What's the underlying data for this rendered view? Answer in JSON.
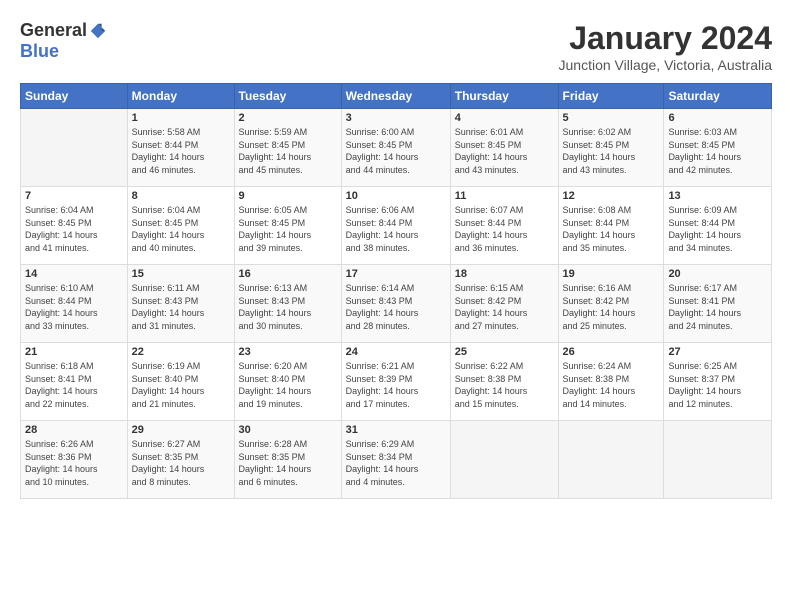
{
  "logo": {
    "general": "General",
    "blue": "Blue"
  },
  "header": {
    "title": "January 2024",
    "location": "Junction Village, Victoria, Australia"
  },
  "weekdays": [
    "Sunday",
    "Monday",
    "Tuesday",
    "Wednesday",
    "Thursday",
    "Friday",
    "Saturday"
  ],
  "weeks": [
    [
      {
        "day": "",
        "info": ""
      },
      {
        "day": "1",
        "info": "Sunrise: 5:58 AM\nSunset: 8:44 PM\nDaylight: 14 hours\nand 46 minutes."
      },
      {
        "day": "2",
        "info": "Sunrise: 5:59 AM\nSunset: 8:45 PM\nDaylight: 14 hours\nand 45 minutes."
      },
      {
        "day": "3",
        "info": "Sunrise: 6:00 AM\nSunset: 8:45 PM\nDaylight: 14 hours\nand 44 minutes."
      },
      {
        "day": "4",
        "info": "Sunrise: 6:01 AM\nSunset: 8:45 PM\nDaylight: 14 hours\nand 43 minutes."
      },
      {
        "day": "5",
        "info": "Sunrise: 6:02 AM\nSunset: 8:45 PM\nDaylight: 14 hours\nand 43 minutes."
      },
      {
        "day": "6",
        "info": "Sunrise: 6:03 AM\nSunset: 8:45 PM\nDaylight: 14 hours\nand 42 minutes."
      }
    ],
    [
      {
        "day": "7",
        "info": "Sunrise: 6:04 AM\nSunset: 8:45 PM\nDaylight: 14 hours\nand 41 minutes."
      },
      {
        "day": "8",
        "info": "Sunrise: 6:04 AM\nSunset: 8:45 PM\nDaylight: 14 hours\nand 40 minutes."
      },
      {
        "day": "9",
        "info": "Sunrise: 6:05 AM\nSunset: 8:45 PM\nDaylight: 14 hours\nand 39 minutes."
      },
      {
        "day": "10",
        "info": "Sunrise: 6:06 AM\nSunset: 8:44 PM\nDaylight: 14 hours\nand 38 minutes."
      },
      {
        "day": "11",
        "info": "Sunrise: 6:07 AM\nSunset: 8:44 PM\nDaylight: 14 hours\nand 36 minutes."
      },
      {
        "day": "12",
        "info": "Sunrise: 6:08 AM\nSunset: 8:44 PM\nDaylight: 14 hours\nand 35 minutes."
      },
      {
        "day": "13",
        "info": "Sunrise: 6:09 AM\nSunset: 8:44 PM\nDaylight: 14 hours\nand 34 minutes."
      }
    ],
    [
      {
        "day": "14",
        "info": "Sunrise: 6:10 AM\nSunset: 8:44 PM\nDaylight: 14 hours\nand 33 minutes."
      },
      {
        "day": "15",
        "info": "Sunrise: 6:11 AM\nSunset: 8:43 PM\nDaylight: 14 hours\nand 31 minutes."
      },
      {
        "day": "16",
        "info": "Sunrise: 6:13 AM\nSunset: 8:43 PM\nDaylight: 14 hours\nand 30 minutes."
      },
      {
        "day": "17",
        "info": "Sunrise: 6:14 AM\nSunset: 8:43 PM\nDaylight: 14 hours\nand 28 minutes."
      },
      {
        "day": "18",
        "info": "Sunrise: 6:15 AM\nSunset: 8:42 PM\nDaylight: 14 hours\nand 27 minutes."
      },
      {
        "day": "19",
        "info": "Sunrise: 6:16 AM\nSunset: 8:42 PM\nDaylight: 14 hours\nand 25 minutes."
      },
      {
        "day": "20",
        "info": "Sunrise: 6:17 AM\nSunset: 8:41 PM\nDaylight: 14 hours\nand 24 minutes."
      }
    ],
    [
      {
        "day": "21",
        "info": "Sunrise: 6:18 AM\nSunset: 8:41 PM\nDaylight: 14 hours\nand 22 minutes."
      },
      {
        "day": "22",
        "info": "Sunrise: 6:19 AM\nSunset: 8:40 PM\nDaylight: 14 hours\nand 21 minutes."
      },
      {
        "day": "23",
        "info": "Sunrise: 6:20 AM\nSunset: 8:40 PM\nDaylight: 14 hours\nand 19 minutes."
      },
      {
        "day": "24",
        "info": "Sunrise: 6:21 AM\nSunset: 8:39 PM\nDaylight: 14 hours\nand 17 minutes."
      },
      {
        "day": "25",
        "info": "Sunrise: 6:22 AM\nSunset: 8:38 PM\nDaylight: 14 hours\nand 15 minutes."
      },
      {
        "day": "26",
        "info": "Sunrise: 6:24 AM\nSunset: 8:38 PM\nDaylight: 14 hours\nand 14 minutes."
      },
      {
        "day": "27",
        "info": "Sunrise: 6:25 AM\nSunset: 8:37 PM\nDaylight: 14 hours\nand 12 minutes."
      }
    ],
    [
      {
        "day": "28",
        "info": "Sunrise: 6:26 AM\nSunset: 8:36 PM\nDaylight: 14 hours\nand 10 minutes."
      },
      {
        "day": "29",
        "info": "Sunrise: 6:27 AM\nSunset: 8:35 PM\nDaylight: 14 hours\nand 8 minutes."
      },
      {
        "day": "30",
        "info": "Sunrise: 6:28 AM\nSunset: 8:35 PM\nDaylight: 14 hours\nand 6 minutes."
      },
      {
        "day": "31",
        "info": "Sunrise: 6:29 AM\nSunset: 8:34 PM\nDaylight: 14 hours\nand 4 minutes."
      },
      {
        "day": "",
        "info": ""
      },
      {
        "day": "",
        "info": ""
      },
      {
        "day": "",
        "info": ""
      }
    ]
  ]
}
